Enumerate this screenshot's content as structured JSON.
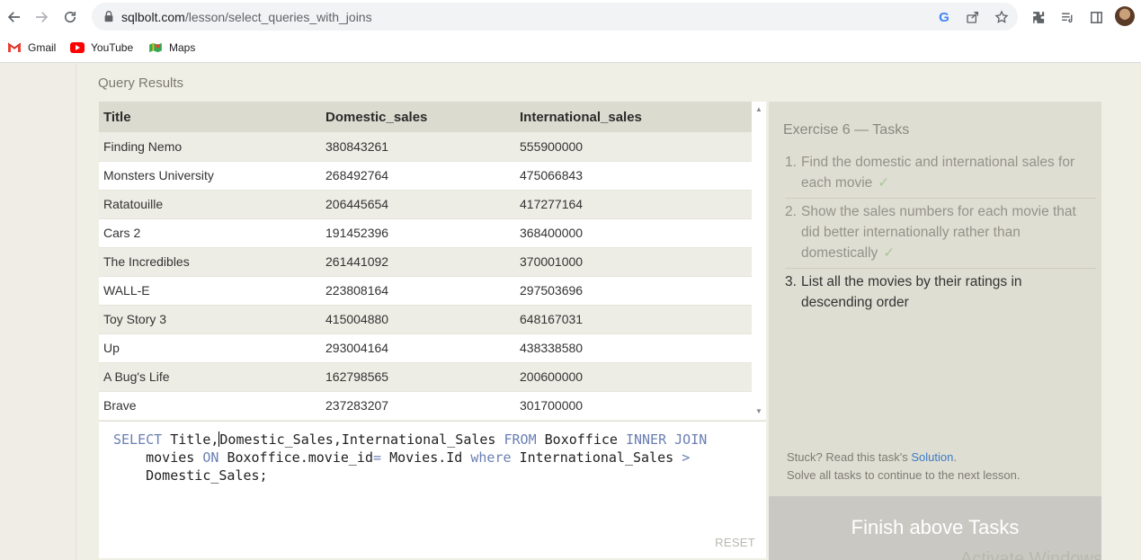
{
  "browser": {
    "url_domain": "sqlbolt.com",
    "url_path": "/lesson/select_queries_with_joins",
    "bookmarks": [
      "Gmail",
      "YouTube",
      "Maps"
    ],
    "colors": {
      "accent": "#4285f4",
      "youtube": "#ff0000"
    }
  },
  "results": {
    "title": "Query Results",
    "columns": [
      "Title",
      "Domestic_sales",
      "International_sales"
    ],
    "rows": [
      [
        "Finding Nemo",
        "380843261",
        "555900000"
      ],
      [
        "Monsters University",
        "268492764",
        "475066843"
      ],
      [
        "Ratatouille",
        "206445654",
        "417277164"
      ],
      [
        "Cars 2",
        "191452396",
        "368400000"
      ],
      [
        "The Incredibles",
        "261441092",
        "370001000"
      ],
      [
        "WALL-E",
        "223808164",
        "297503696"
      ],
      [
        "Toy Story 3",
        "415004880",
        "648167031"
      ],
      [
        "Up",
        "293004164",
        "438338580"
      ],
      [
        "A Bug's Life",
        "162798565",
        "200600000"
      ],
      [
        "Brave",
        "237283207",
        "301700000"
      ]
    ]
  },
  "editor": {
    "line1_kw1": "SELECT",
    "line1_a": "Title,",
    "line1_b": "Domestic_Sales,International_Sales",
    "line1_kw2": "FROM",
    "line1_c": "Boxoffice",
    "line1_kw3": "INNER JOIN",
    "line2_a": "movies",
    "line2_kw1": "ON",
    "line2_b": "Boxoffice.movie_id",
    "line2_op": "=",
    "line2_c": "Movies.Id",
    "line2_kw2": "where",
    "line2_d": "International_Sales",
    "line2_op2": ">",
    "line3": "Domestic_Sales;",
    "reset_label": "RESET"
  },
  "tasks": {
    "title": "Exercise 6 — Tasks",
    "items": [
      {
        "num": "1.",
        "text": "Find the domestic and international sales for each movie",
        "done": true,
        "check": "✓"
      },
      {
        "num": "2.",
        "text": "Show the sales numbers for each movie that did better internationally rather than domestically",
        "done": true,
        "check": "✓"
      },
      {
        "num": "3.",
        "text": "List all the movies by their ratings in descending order",
        "done": false,
        "check": ""
      }
    ],
    "stuck_prefix": "Stuck? Read this task's ",
    "solution_link": "Solution",
    "stuck_suffix": ".",
    "continue_text": "Solve all tasks to continue to the next lesson.",
    "finish_label": "Finish above Tasks"
  },
  "watermark": "Activate Windows"
}
